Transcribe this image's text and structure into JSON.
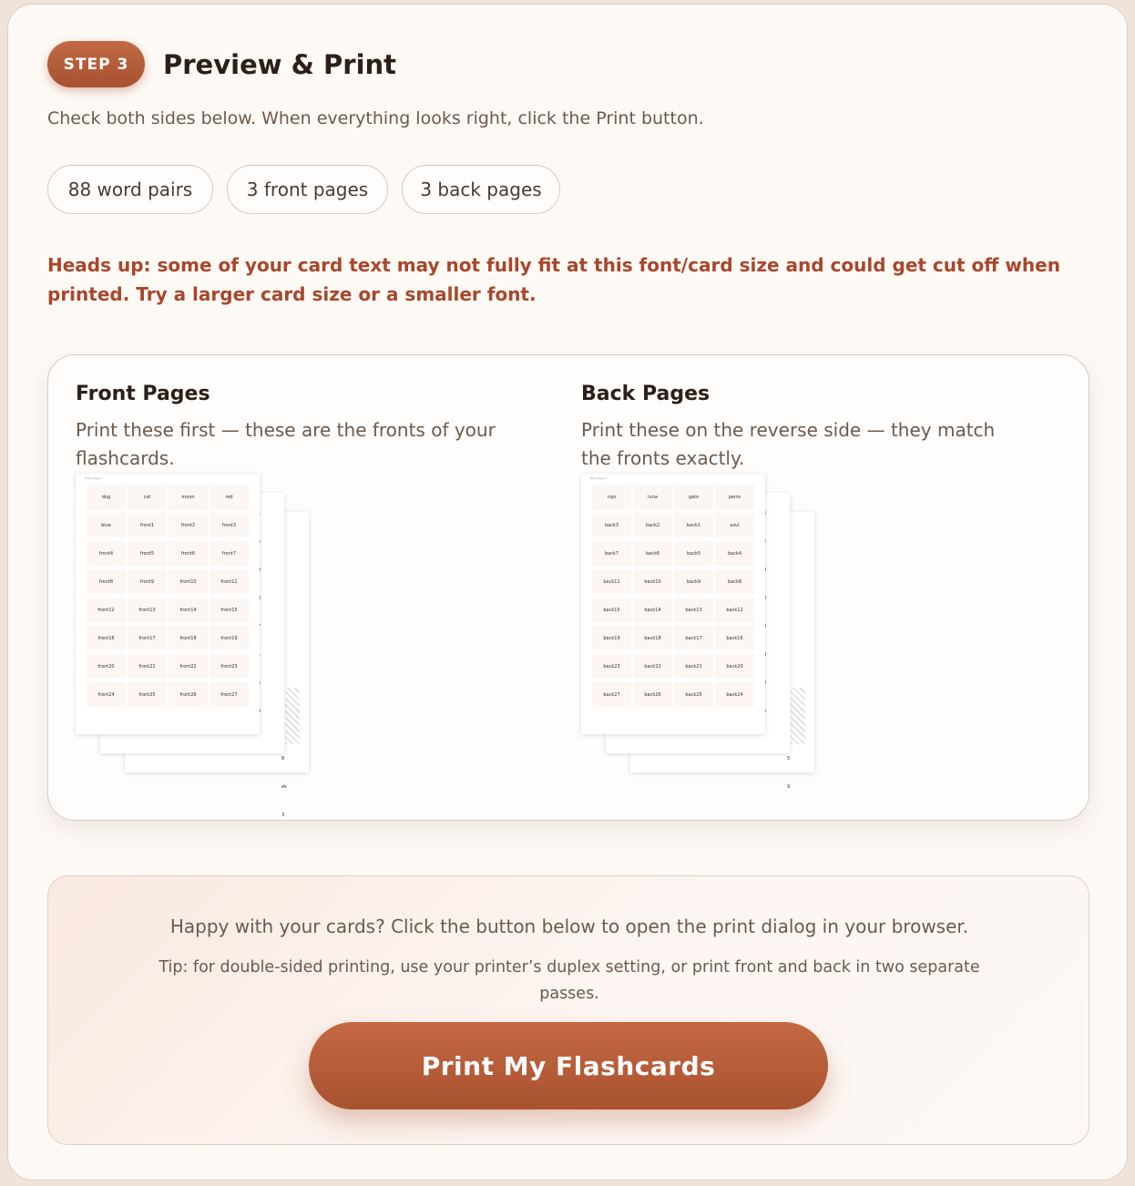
{
  "step": {
    "badge": "STEP 3",
    "title": "Preview & Print",
    "intro": "Check both sides below. When everything looks right, click the Print button."
  },
  "stats": [
    {
      "label": "88 word pairs"
    },
    {
      "label": "3 front pages"
    },
    {
      "label": "3 back pages"
    }
  ],
  "warning": "Heads up: some of your card text may not fully fit at this font/card size and could get cut off when printed. Try a larger card size or a smaller font.",
  "front": {
    "title": "Front Pages",
    "description": "Print these first — these are the fronts of your flashcards.",
    "page_header": "Front Page 1",
    "cells": [
      "dog",
      "cat",
      "moon",
      "red",
      "blue",
      "front1",
      "front2",
      "front3",
      "front4",
      "front5",
      "front6",
      "front7",
      "front8",
      "front9",
      "front10",
      "front11",
      "front12",
      "front13",
      "front14",
      "front15",
      "front16",
      "front17",
      "front18",
      "front19",
      "front20",
      "front21",
      "front22",
      "front23",
      "front24",
      "front25",
      "front26",
      "front27"
    ],
    "peek_page2": [
      "1",
      "5",
      "9",
      "3",
      "7",
      "1",
      "5",
      "9"
    ],
    "peek_page3": [
      "6",
      "0",
      "4",
      "8",
      "2",
      "6",
      "0",
      "4",
      "8",
      "ek",
      "3"
    ]
  },
  "back": {
    "title": "Back Pages",
    "description": "Print these on the reverse side — they match the fronts exactly.",
    "page_header": "Back Page 1",
    "cells": [
      "rojo",
      "luna",
      "gato",
      "perro",
      "back3",
      "back2",
      "back1",
      "azul",
      "back7",
      "back6",
      "back5",
      "back4",
      "back11",
      "back10",
      "back9",
      "back8",
      "back15",
      "back14",
      "back13",
      "back12",
      "back19",
      "back18",
      "back17",
      "back16",
      "back23",
      "back22",
      "back21",
      "back20",
      "back27",
      "back26",
      "back25",
      "back24"
    ],
    "peek_page2": [
      "6",
      "2",
      "4",
      "0",
      "0",
      "4",
      "0",
      "5"
    ],
    "peek_page3": [
      "3",
      "7",
      "1",
      "5",
      "9",
      "3",
      "7",
      "1",
      "5",
      "9"
    ]
  },
  "print": {
    "message": "Happy with your cards? Click the button below to open the print dialog in your browser.",
    "tip": "Tip: for double-sided printing, use your printer’s duplex setting, or print front and back in two separate passes.",
    "button_label": "Print My Flashcards"
  }
}
